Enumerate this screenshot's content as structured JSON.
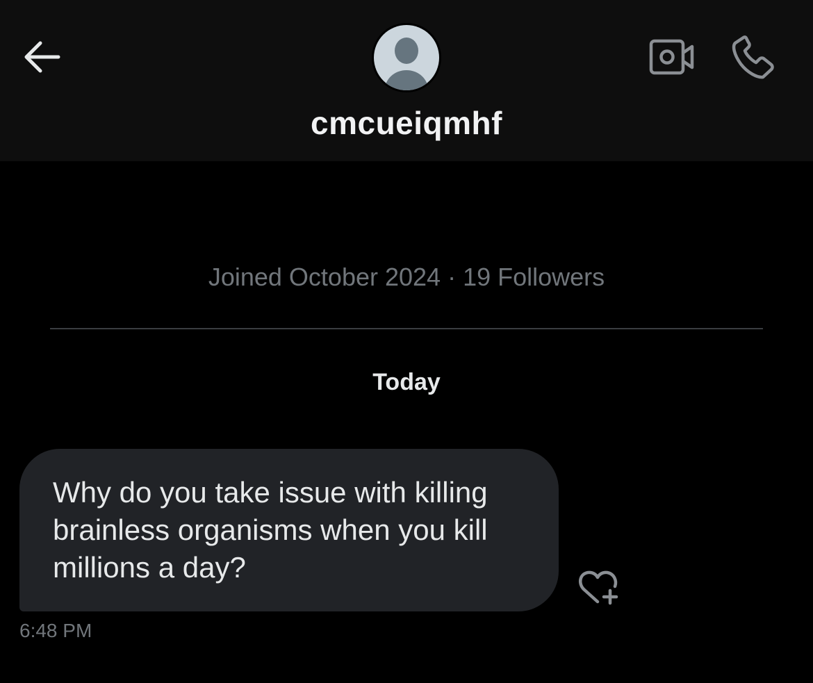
{
  "header": {
    "back_icon": "arrow-left-icon",
    "avatar_icon": "default-user-avatar",
    "username": "cmcueiqmhf",
    "video_icon": "video-camera-icon",
    "call_icon": "phone-icon"
  },
  "profile": {
    "meta": "Joined October 2024 · 19 Followers"
  },
  "conversation": {
    "date_separator": "Today",
    "messages": [
      {
        "text": "Why do you take issue with killing brainless organisms when you kill millions a day?",
        "time": "6:48 PM",
        "react_icon": "heart-plus-icon"
      }
    ]
  },
  "colors": {
    "background": "#000000",
    "header_background": "#0e0e0e",
    "bubble": "#212327",
    "muted_text": "#71767b",
    "primary_text": "#e7e9ea",
    "avatar_bg": "#ccd6dd",
    "avatar_figure": "#66757f"
  }
}
